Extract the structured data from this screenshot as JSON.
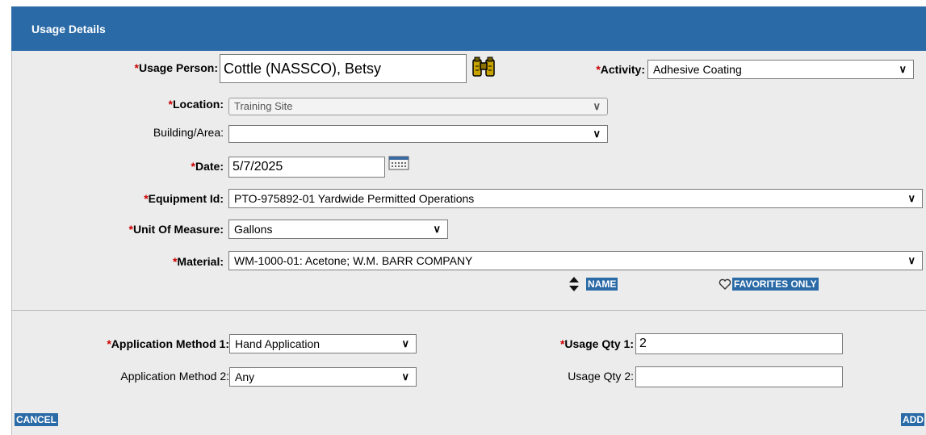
{
  "header": {
    "title": "Usage Details"
  },
  "fields": {
    "usage_person": {
      "label": "Usage Person:",
      "value": "Cottle (NASSCO), Betsy"
    },
    "activity": {
      "label": "Activity:",
      "value": "Adhesive Coating"
    },
    "location": {
      "label": "Location:",
      "value": "Training Site"
    },
    "building_area": {
      "label": "Building/Area:",
      "value": ""
    },
    "date": {
      "label": "Date:",
      "value": "5/7/2025"
    },
    "equipment_id": {
      "label": "Equipment Id:",
      "value": "PTO-975892-01 Yardwide Permitted Operations"
    },
    "unit_of_measure": {
      "label": "Unit Of Measure:",
      "value": "Gallons"
    },
    "material": {
      "label": "Material:",
      "value": "WM-1000-01: Acetone; W.M. BARR COMPANY"
    },
    "application_method_1": {
      "label": "Application Method 1:",
      "value": "Hand Application"
    },
    "application_method_2": {
      "label": "Application Method 2:",
      "value": "Any"
    },
    "usage_qty_1": {
      "label": "Usage Qty 1:",
      "value": "2"
    },
    "usage_qty_2": {
      "label": "Usage Qty 2:",
      "value": ""
    }
  },
  "required_marker": "*",
  "sort": {
    "label": "NAME"
  },
  "favorites": {
    "label": "FAVORITES ONLY"
  },
  "actions": {
    "cancel": "CANCEL",
    "add": "ADD"
  },
  "icons": {
    "lookup": "binoculars-icon",
    "calendar": "calendar-icon",
    "sort": "sort-updown-icon",
    "favorites": "heart-icon"
  },
  "colors": {
    "header_bg": "#2a6aa6",
    "panel_bg": "#ececec",
    "required": "#cc0000"
  }
}
